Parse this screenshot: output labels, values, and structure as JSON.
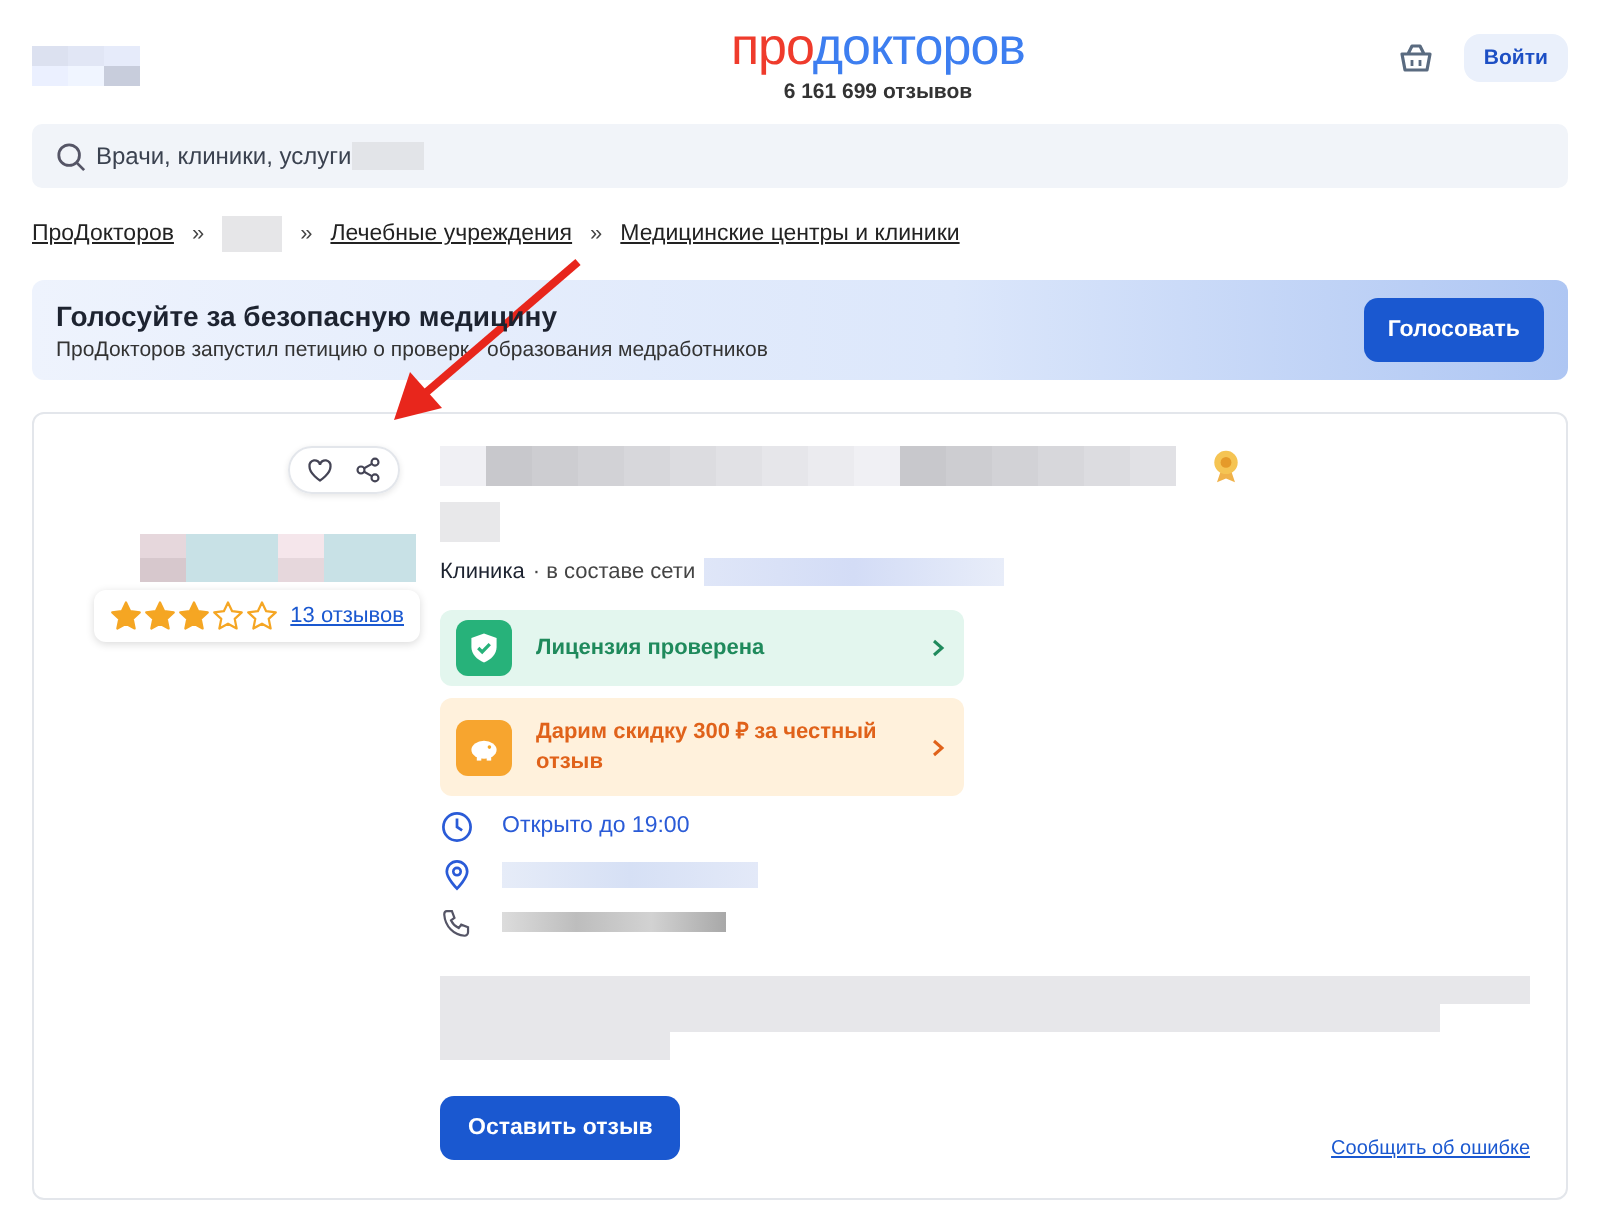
{
  "header": {
    "logo_first": "про",
    "logo_second": "докторов",
    "review_count": "6 161 699 отзывов",
    "login_button": "Войти"
  },
  "search": {
    "placeholder": "Врачи, клиники, услуги"
  },
  "breadcrumbs": [
    {
      "kind": "link",
      "label": "ПроДокторов"
    },
    {
      "kind": "hidden",
      "separator": "»"
    },
    {
      "kind": "link",
      "separator": "»",
      "label": "Лечебные учреждения"
    },
    {
      "kind": "link",
      "separator": "»",
      "label": "Медицинские центры и клиники"
    }
  ],
  "banner": {
    "title": "Голосуйте за безопасную медицину",
    "text_before_arrow": "ПроДокторов запустил петицию о проверк",
    "text_after_arrow": "образования медработников",
    "button": "Голосовать"
  },
  "clinic": {
    "stars": 3,
    "reviews_link": "13 отзывов",
    "type": "Клиника",
    "network": "· в составе сети",
    "badges": [
      {
        "kind": "license",
        "label": "Лицензия проверена"
      },
      {
        "kind": "discount",
        "label": "Дарим скидку 300 ₽ за честный отзыв"
      }
    ],
    "hours": "Открыто до 19:00",
    "review_button": "Оставить отзыв",
    "report_link": "Сообщить об ошибке"
  }
}
